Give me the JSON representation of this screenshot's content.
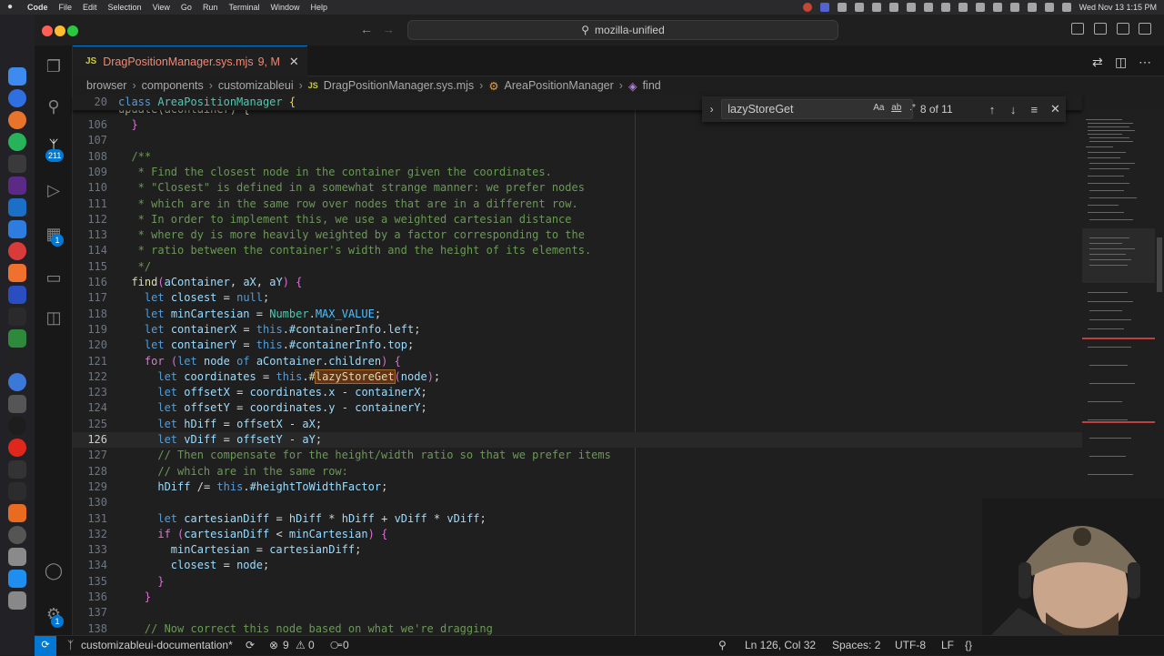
{
  "menubar": {
    "app": "Code",
    "items": [
      "File",
      "Edit",
      "Selection",
      "View",
      "Go",
      "Run",
      "Terminal",
      "Window",
      "Help"
    ],
    "clock": "Wed Nov 13  1:15 PM"
  },
  "titlebar": {
    "search": "mozilla-unified"
  },
  "activitybar": {
    "scm_badge": "211",
    "extensions_badge": "1"
  },
  "tab": {
    "icon": "JS",
    "filename": "DragPositionManager.sys.mjs",
    "problems": "9, M"
  },
  "breadcrumb": {
    "parts": [
      "browser",
      "components",
      "customizableui"
    ],
    "file_icon": "JS",
    "file": "DragPositionManager.sys.mjs",
    "class": "AreaPositionManager",
    "method": "find"
  },
  "find": {
    "query": "lazyStoreGet",
    "match_case": "Aa",
    "whole_word": "ab",
    "regex": ".*",
    "count": "8 of 11"
  },
  "editor": {
    "sticky_line": {
      "num": "20",
      "text": "class AreaPositionManager {"
    },
    "partial_line_text": "update(aContainer) {",
    "lines": [
      {
        "num": "106",
        "text": "  }"
      },
      {
        "num": "107",
        "text": ""
      },
      {
        "num": "108",
        "text": "  /**"
      },
      {
        "num": "109",
        "text": "   * Find the closest node in the container given the coordinates."
      },
      {
        "num": "110",
        "text": "   * \"Closest\" is defined in a somewhat strange manner: we prefer nodes"
      },
      {
        "num": "111",
        "text": "   * which are in the same row over nodes that are in a different row."
      },
      {
        "num": "112",
        "text": "   * In order to implement this, we use a weighted cartesian distance"
      },
      {
        "num": "113",
        "text": "   * where dy is more heavily weighted by a factor corresponding to the"
      },
      {
        "num": "114",
        "text": "   * ratio between the container's width and the height of its elements."
      },
      {
        "num": "115",
        "text": "   */"
      },
      {
        "num": "116",
        "text": "  find(aContainer, aX, aY) {"
      },
      {
        "num": "117",
        "text": "    let closest = null;"
      },
      {
        "num": "118",
        "text": "    let minCartesian = Number.MAX_VALUE;"
      },
      {
        "num": "119",
        "text": "    let containerX = this.#containerInfo.left;"
      },
      {
        "num": "120",
        "text": "    let containerY = this.#containerInfo.top;"
      },
      {
        "num": "121",
        "text": "    for (let node of aContainer.children) {"
      },
      {
        "num": "122",
        "text": "      let coordinates = this.#lazyStoreGet(node);"
      },
      {
        "num": "123",
        "text": "      let offsetX = coordinates.x - containerX;"
      },
      {
        "num": "124",
        "text": "      let offsetY = coordinates.y - containerY;"
      },
      {
        "num": "125",
        "text": "      let hDiff = offsetX - aX;"
      },
      {
        "num": "126",
        "text": "      let vDiff = offsetY - aY;"
      },
      {
        "num": "127",
        "text": "      // Then compensate for the height/width ratio so that we prefer items"
      },
      {
        "num": "128",
        "text": "      // which are in the same row:"
      },
      {
        "num": "129",
        "text": "      hDiff /= this.#heightToWidthFactor;"
      },
      {
        "num": "130",
        "text": ""
      },
      {
        "num": "131",
        "text": "      let cartesianDiff = hDiff * hDiff + vDiff * vDiff;"
      },
      {
        "num": "132",
        "text": "      if (cartesianDiff < minCartesian) {"
      },
      {
        "num": "133",
        "text": "        minCartesian = cartesianDiff;"
      },
      {
        "num": "134",
        "text": "        closest = node;"
      },
      {
        "num": "135",
        "text": "      }"
      },
      {
        "num": "136",
        "text": "    }"
      },
      {
        "num": "137",
        "text": ""
      },
      {
        "num": "138",
        "text": "    // Now correct this node based on what we're dragging"
      }
    ],
    "current_line": "126"
  },
  "statusbar": {
    "branch": "customizableui-documentation*",
    "errors": "9",
    "warnings": "0",
    "ports": "0",
    "position": "Ln 126, Col 32",
    "spaces": "Spaces: 2",
    "encoding": "UTF-8",
    "eol": "LF",
    "language": "{}"
  },
  "colors": {
    "accent": "#0078d4",
    "editor_bg": "#1f1f1f",
    "tab_modified": "#f48771"
  }
}
